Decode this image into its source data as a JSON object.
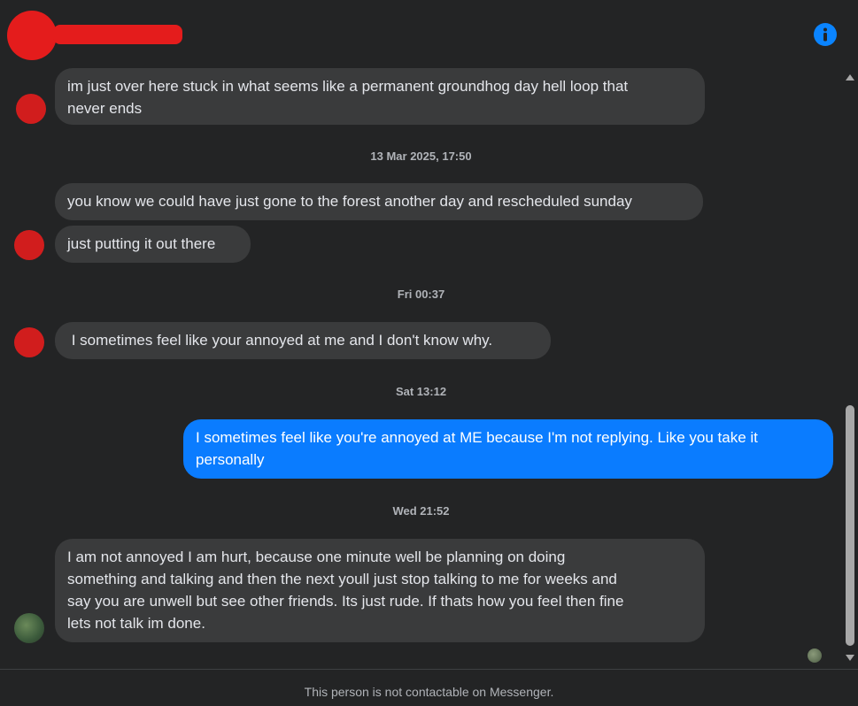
{
  "header": {
    "contact_name": "",
    "info_icon": "info-icon",
    "accent_color": "#0a84ff"
  },
  "messages": [
    {
      "type": "message",
      "direction": "incoming",
      "text": "im just over here stuck in what seems like a permanent groundhog day hell loop that\nnever ends"
    },
    {
      "type": "timestamp",
      "text": "13 Mar 2025, 17:50"
    },
    {
      "type": "message",
      "direction": "incoming",
      "text": "you know we could have just gone to the forest another day and rescheduled sunday"
    },
    {
      "type": "message",
      "direction": "incoming",
      "text": "just putting it out there"
    },
    {
      "type": "timestamp",
      "text": "Fri 00:37"
    },
    {
      "type": "message",
      "direction": "incoming",
      "text": " I sometimes feel like your annoyed at me and I don't know why."
    },
    {
      "type": "timestamp",
      "text": "Sat 13:12"
    },
    {
      "type": "message",
      "direction": "outgoing",
      "text": "I sometimes feel like you're annoyed at ME because I'm not replying. Like you take it\npersonally"
    },
    {
      "type": "timestamp",
      "text": "Wed 21:52"
    },
    {
      "type": "message",
      "direction": "incoming",
      "text": "I am not annoyed I am hurt, because one minute well be planning on doing\nsomething and talking and then the next youll just stop talking to me for weeks and\nsay you are unwell but see other friends. Its just rude. If thats how you feel then fine\nlets not talk im done."
    }
  ],
  "footer": {
    "notice": "This person is not contactable on Messenger."
  },
  "colors": {
    "background": "#232425",
    "incoming_bubble": "#3a3b3c",
    "outgoing_bubble": "#0a7cff"
  }
}
